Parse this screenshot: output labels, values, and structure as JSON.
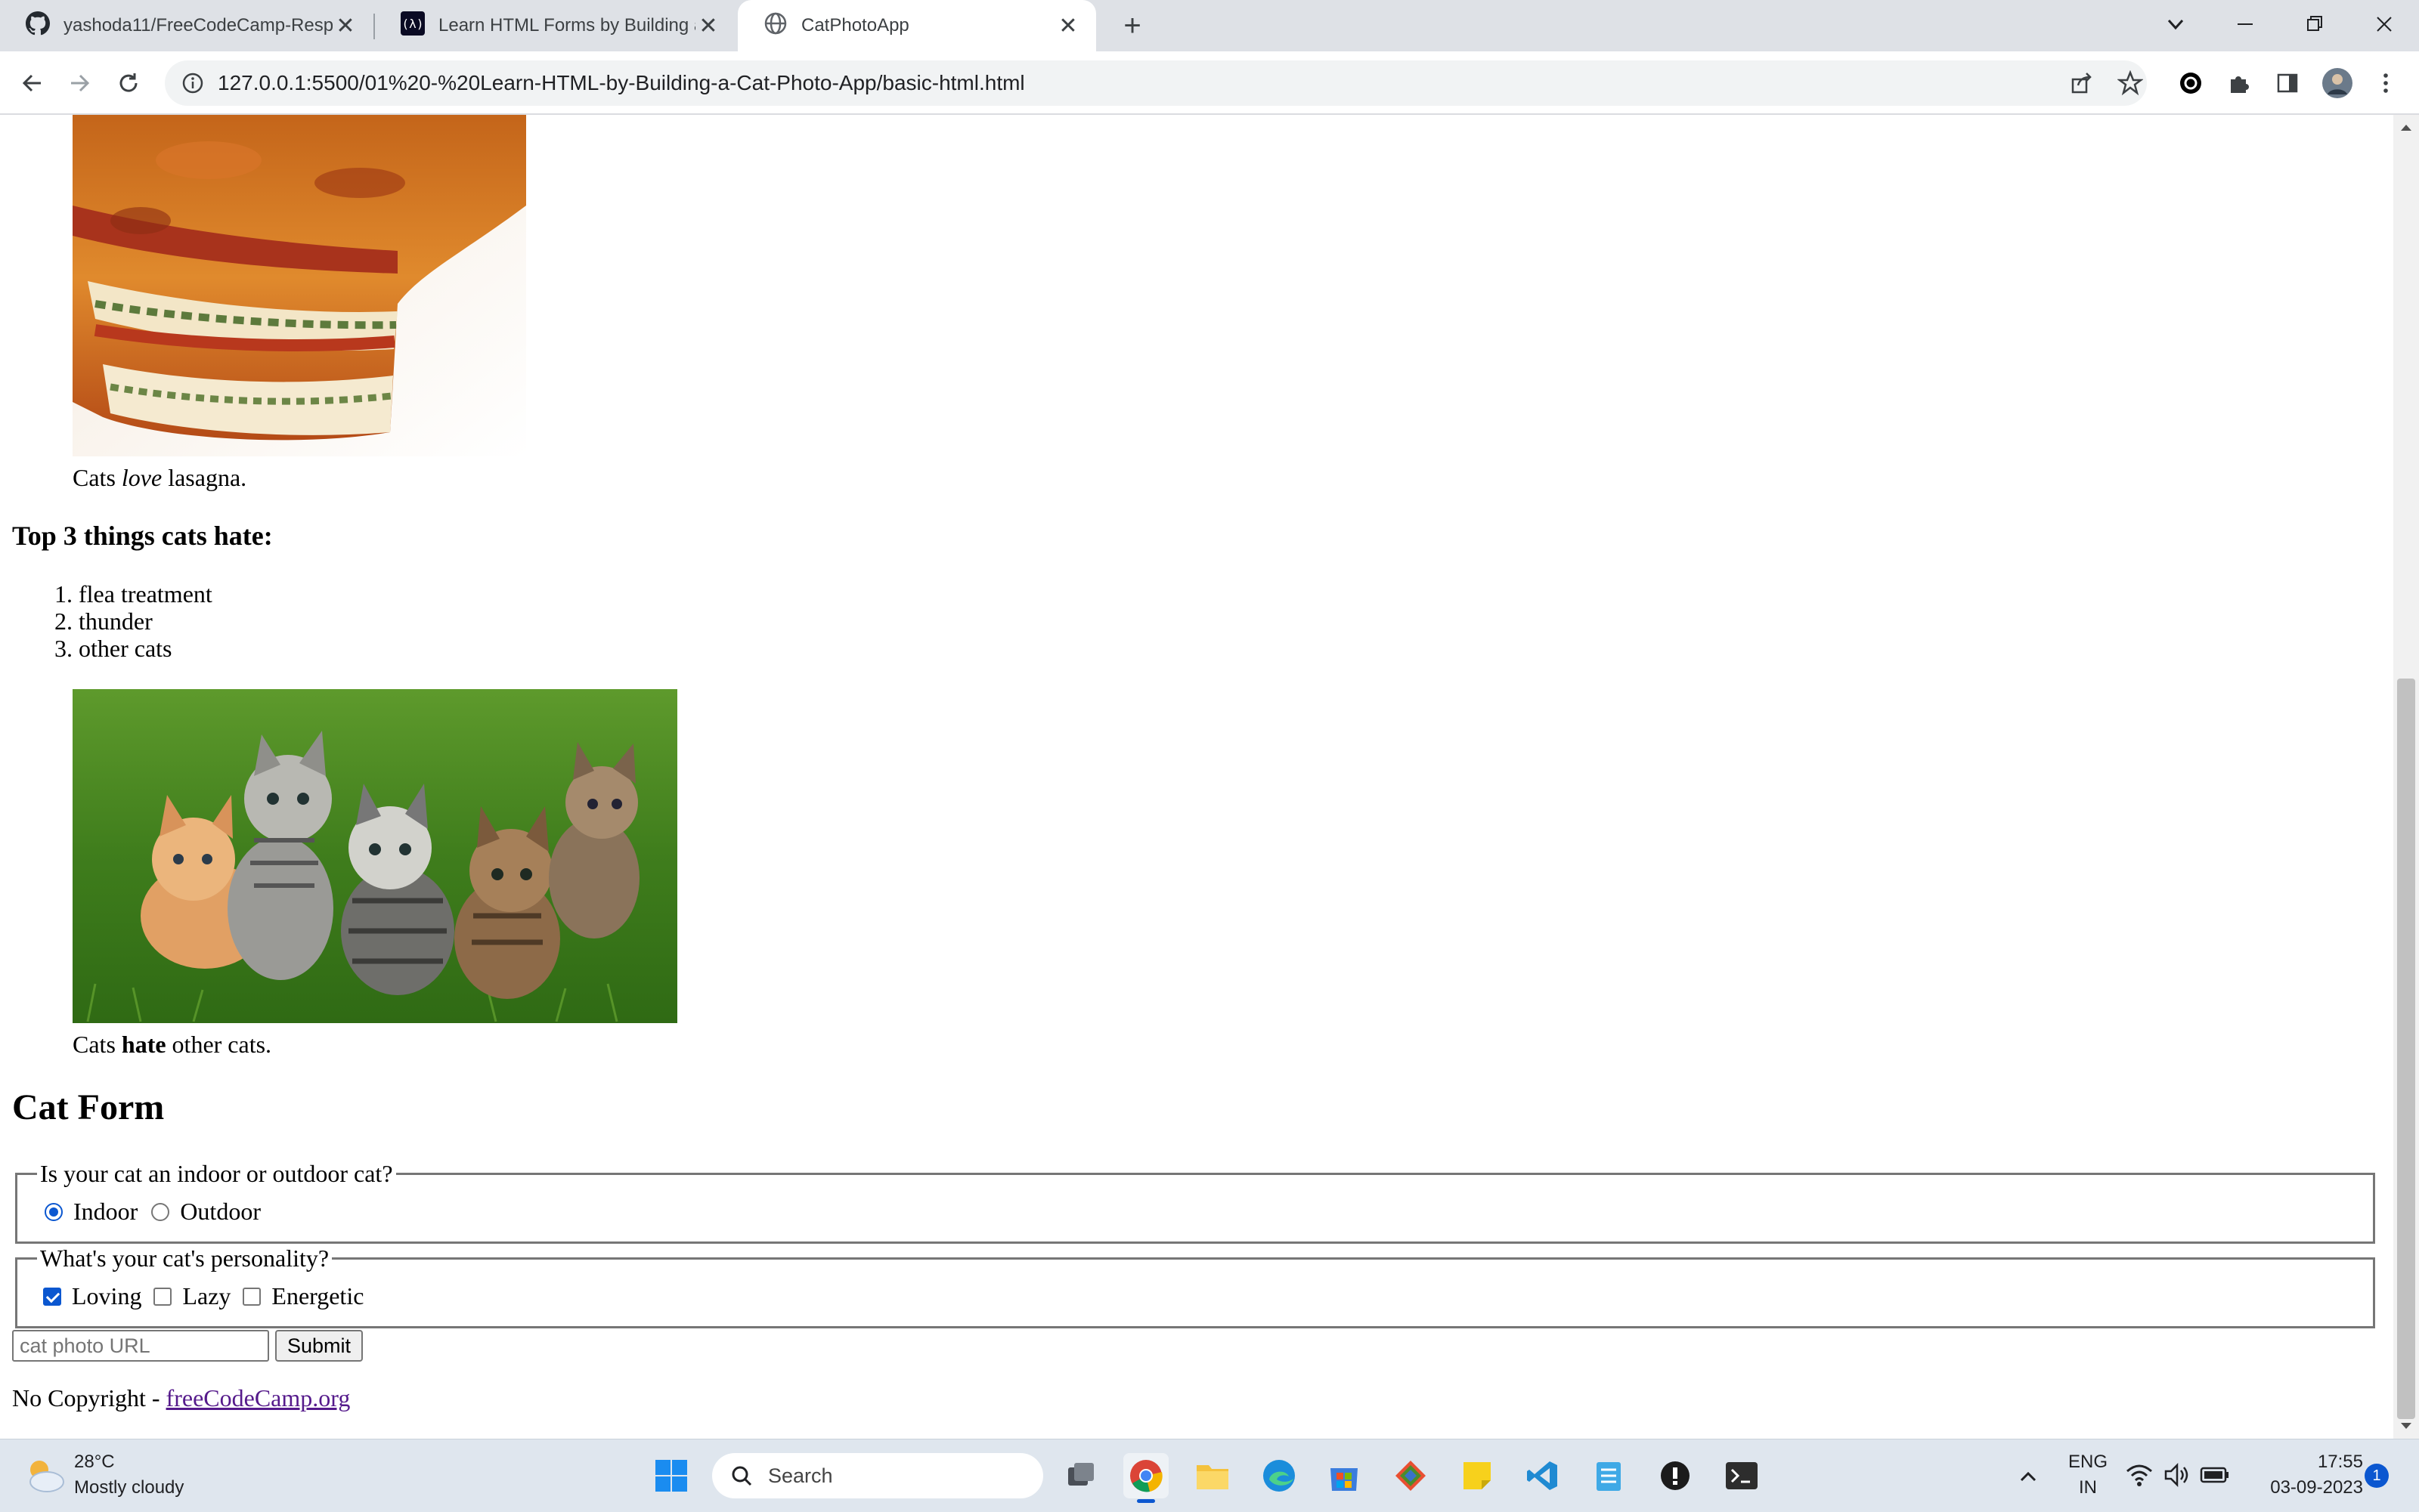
{
  "browser": {
    "tabs": [
      {
        "title": "yashoda11/FreeCodeCamp-Resp",
        "icon": "github-icon",
        "active": false
      },
      {
        "title": "Learn HTML Forms by Building a",
        "icon": "freecodecamp-icon",
        "active": false
      },
      {
        "title": "CatPhotoApp",
        "icon": "globe-icon",
        "active": true
      }
    ],
    "new_tab_label": "+",
    "url": "127.0.0.1:5500/01%20-%20Learn-HTML-by-Building-a-Cat-Photo-App/basic-html.html"
  },
  "page": {
    "lasagna_caption": {
      "before": "Cats ",
      "em": "love",
      "after": " lasagna."
    },
    "hate_heading": "Top 3 things cats hate:",
    "hate_list": [
      {
        "num": "1.",
        "text": "flea treatment"
      },
      {
        "num": "2.",
        "text": "thunder"
      },
      {
        "num": "3.",
        "text": "other cats"
      }
    ],
    "kittens_caption": {
      "before": "Cats ",
      "strong": "hate",
      "after": " other cats."
    },
    "form_heading": "Cat Form",
    "form": {
      "location_legend": "Is your cat an indoor or outdoor cat?",
      "indoor_label": "Indoor",
      "outdoor_label": "Outdoor",
      "personality_legend": "What's your cat's personality?",
      "loving_label": "Loving",
      "lazy_label": "Lazy",
      "energetic_label": "Energetic",
      "url_placeholder": "cat photo URL",
      "submit_label": "Submit"
    },
    "footer": {
      "prefix": "No Copyright - ",
      "link_text": "freeCodeCamp.org"
    }
  },
  "taskbar": {
    "weather_temp": "28°C",
    "weather_desc": "Mostly cloudy",
    "search_placeholder": "Search",
    "lang_top": "ENG",
    "lang_bottom": "IN",
    "time": "17:55",
    "date": "03-09-2023",
    "notification_count": "1"
  },
  "colors": {
    "accent": "#0b57d0",
    "link_visited": "#551a8b",
    "tab_strip": "#dee1e6",
    "taskbar": "#dfe6ee"
  }
}
